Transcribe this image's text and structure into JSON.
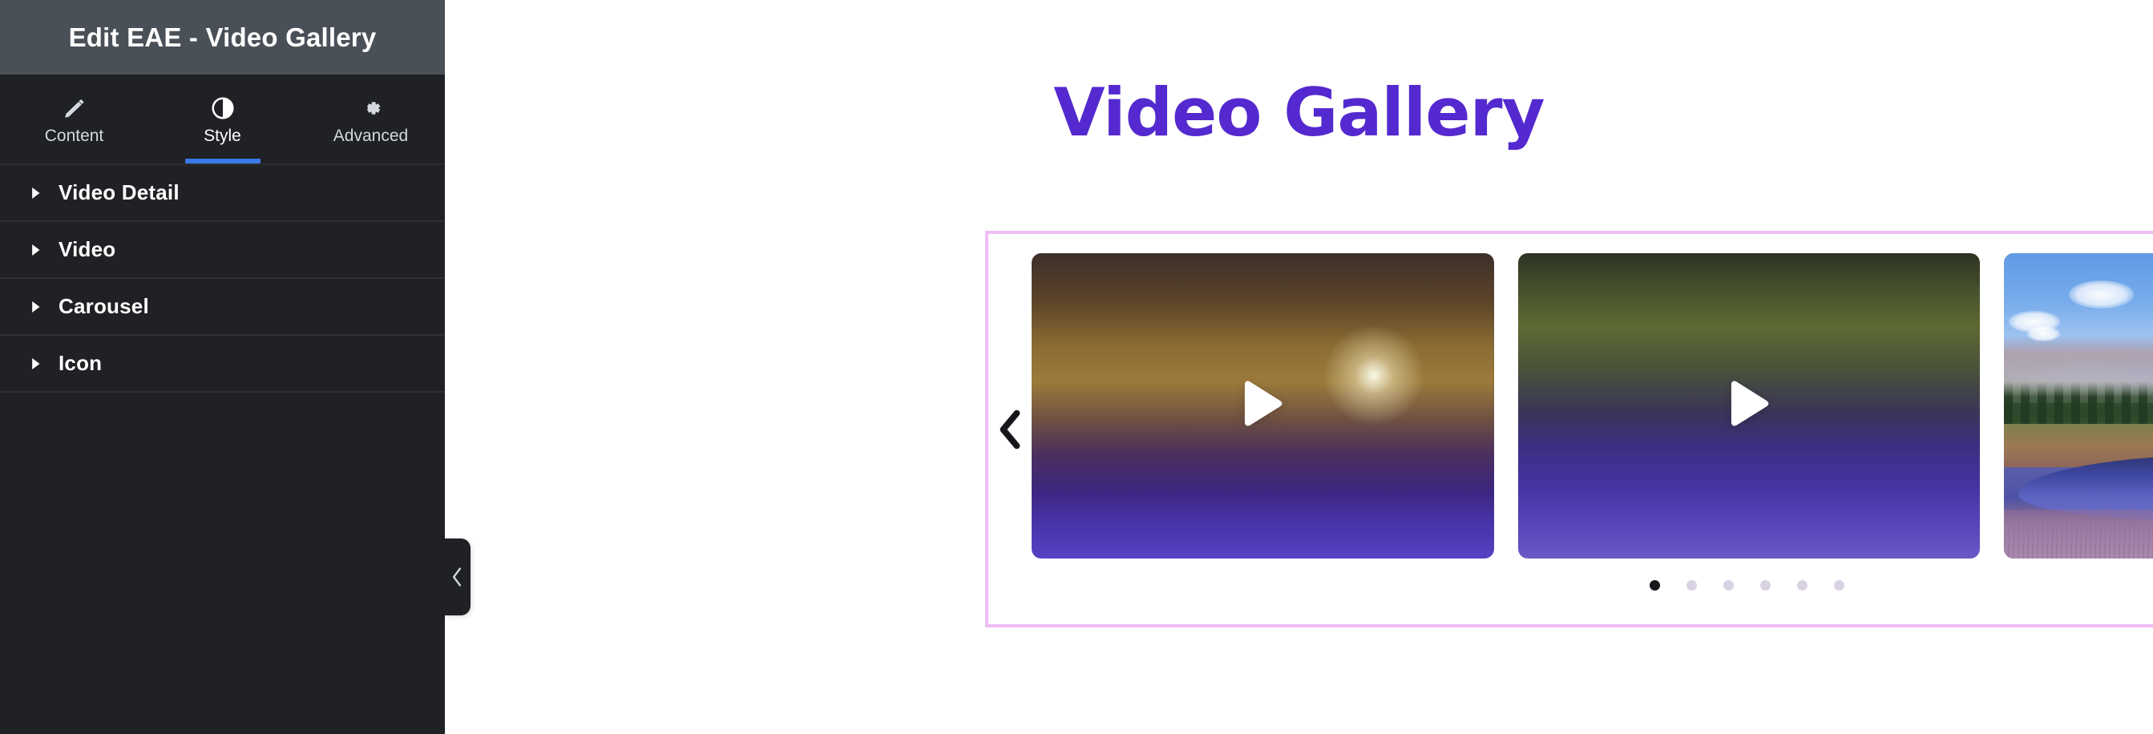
{
  "panel": {
    "title": "Edit EAE - Video Gallery",
    "tabs": [
      {
        "label": "Content",
        "icon": "pencil-icon",
        "active": false
      },
      {
        "label": "Style",
        "icon": "contrast-icon",
        "active": true
      },
      {
        "label": "Advanced",
        "icon": "gear-icon",
        "active": false
      }
    ],
    "sections": [
      {
        "label": "Video Detail",
        "expanded": false
      },
      {
        "label": "Video",
        "expanded": false
      },
      {
        "label": "Carousel",
        "expanded": false
      },
      {
        "label": "Icon",
        "expanded": false
      }
    ],
    "collapse_handle_icon": "chevron-left-icon",
    "colors": {
      "header_bg": "#4a5058",
      "body_bg": "#1f2124",
      "active_tab_underline": "#3a7ae8",
      "text": "#ffffff"
    }
  },
  "canvas": {
    "heading": "Video Gallery",
    "heading_color": "#5429cf",
    "selection_border_color": "#efbdf5",
    "carousel": {
      "prev_icon": "chevron-left-icon",
      "next_icon": "chevron-right-icon",
      "play_icon": "play-triangle-icon",
      "slides": [
        {
          "name": "autumn-forest-creek",
          "alt": "Autumn forest creek with sun flare"
        },
        {
          "name": "waterfall-canyon",
          "alt": "Waterfall in a green forest canyon"
        },
        {
          "name": "dolomites-lake",
          "alt": "Mountain range reflected in an alpine lake"
        }
      ],
      "dots": {
        "count": 6,
        "active_index": 0,
        "active_color": "#17161b",
        "inactive_color": "#d9d2e3"
      }
    }
  }
}
